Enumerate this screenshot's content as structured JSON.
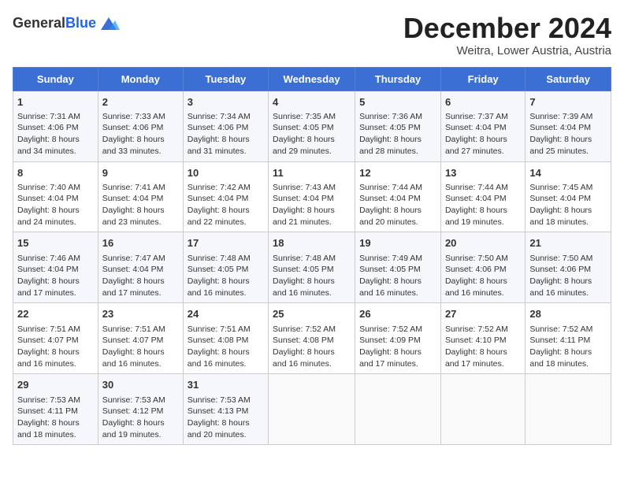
{
  "header": {
    "logo_general": "General",
    "logo_blue": "Blue",
    "month_title": "December 2024",
    "location": "Weitra, Lower Austria, Austria"
  },
  "days_of_week": [
    "Sunday",
    "Monday",
    "Tuesday",
    "Wednesday",
    "Thursday",
    "Friday",
    "Saturday"
  ],
  "weeks": [
    [
      {
        "day": "1",
        "sunrise": "7:31 AM",
        "sunset": "4:06 PM",
        "daylight": "8 hours and 34 minutes."
      },
      {
        "day": "2",
        "sunrise": "7:33 AM",
        "sunset": "4:06 PM",
        "daylight": "8 hours and 33 minutes."
      },
      {
        "day": "3",
        "sunrise": "7:34 AM",
        "sunset": "4:06 PM",
        "daylight": "8 hours and 31 minutes."
      },
      {
        "day": "4",
        "sunrise": "7:35 AM",
        "sunset": "4:05 PM",
        "daylight": "8 hours and 29 minutes."
      },
      {
        "day": "5",
        "sunrise": "7:36 AM",
        "sunset": "4:05 PM",
        "daylight": "8 hours and 28 minutes."
      },
      {
        "day": "6",
        "sunrise": "7:37 AM",
        "sunset": "4:04 PM",
        "daylight": "8 hours and 27 minutes."
      },
      {
        "day": "7",
        "sunrise": "7:39 AM",
        "sunset": "4:04 PM",
        "daylight": "8 hours and 25 minutes."
      }
    ],
    [
      {
        "day": "8",
        "sunrise": "7:40 AM",
        "sunset": "4:04 PM",
        "daylight": "8 hours and 24 minutes."
      },
      {
        "day": "9",
        "sunrise": "7:41 AM",
        "sunset": "4:04 PM",
        "daylight": "8 hours and 23 minutes."
      },
      {
        "day": "10",
        "sunrise": "7:42 AM",
        "sunset": "4:04 PM",
        "daylight": "8 hours and 22 minutes."
      },
      {
        "day": "11",
        "sunrise": "7:43 AM",
        "sunset": "4:04 PM",
        "daylight": "8 hours and 21 minutes."
      },
      {
        "day": "12",
        "sunrise": "7:44 AM",
        "sunset": "4:04 PM",
        "daylight": "8 hours and 20 minutes."
      },
      {
        "day": "13",
        "sunrise": "7:44 AM",
        "sunset": "4:04 PM",
        "daylight": "8 hours and 19 minutes."
      },
      {
        "day": "14",
        "sunrise": "7:45 AM",
        "sunset": "4:04 PM",
        "daylight": "8 hours and 18 minutes."
      }
    ],
    [
      {
        "day": "15",
        "sunrise": "7:46 AM",
        "sunset": "4:04 PM",
        "daylight": "8 hours and 17 minutes."
      },
      {
        "day": "16",
        "sunrise": "7:47 AM",
        "sunset": "4:04 PM",
        "daylight": "8 hours and 17 minutes."
      },
      {
        "day": "17",
        "sunrise": "7:48 AM",
        "sunset": "4:05 PM",
        "daylight": "8 hours and 16 minutes."
      },
      {
        "day": "18",
        "sunrise": "7:48 AM",
        "sunset": "4:05 PM",
        "daylight": "8 hours and 16 minutes."
      },
      {
        "day": "19",
        "sunrise": "7:49 AM",
        "sunset": "4:05 PM",
        "daylight": "8 hours and 16 minutes."
      },
      {
        "day": "20",
        "sunrise": "7:50 AM",
        "sunset": "4:06 PM",
        "daylight": "8 hours and 16 minutes."
      },
      {
        "day": "21",
        "sunrise": "7:50 AM",
        "sunset": "4:06 PM",
        "daylight": "8 hours and 16 minutes."
      }
    ],
    [
      {
        "day": "22",
        "sunrise": "7:51 AM",
        "sunset": "4:07 PM",
        "daylight": "8 hours and 16 minutes."
      },
      {
        "day": "23",
        "sunrise": "7:51 AM",
        "sunset": "4:07 PM",
        "daylight": "8 hours and 16 minutes."
      },
      {
        "day": "24",
        "sunrise": "7:51 AM",
        "sunset": "4:08 PM",
        "daylight": "8 hours and 16 minutes."
      },
      {
        "day": "25",
        "sunrise": "7:52 AM",
        "sunset": "4:08 PM",
        "daylight": "8 hours and 16 minutes."
      },
      {
        "day": "26",
        "sunrise": "7:52 AM",
        "sunset": "4:09 PM",
        "daylight": "8 hours and 17 minutes."
      },
      {
        "day": "27",
        "sunrise": "7:52 AM",
        "sunset": "4:10 PM",
        "daylight": "8 hours and 17 minutes."
      },
      {
        "day": "28",
        "sunrise": "7:52 AM",
        "sunset": "4:11 PM",
        "daylight": "8 hours and 18 minutes."
      }
    ],
    [
      {
        "day": "29",
        "sunrise": "7:53 AM",
        "sunset": "4:11 PM",
        "daylight": "8 hours and 18 minutes."
      },
      {
        "day": "30",
        "sunrise": "7:53 AM",
        "sunset": "4:12 PM",
        "daylight": "8 hours and 19 minutes."
      },
      {
        "day": "31",
        "sunrise": "7:53 AM",
        "sunset": "4:13 PM",
        "daylight": "8 hours and 20 minutes."
      },
      null,
      null,
      null,
      null
    ]
  ],
  "labels": {
    "sunrise": "Sunrise:",
    "sunset": "Sunset:",
    "daylight": "Daylight:"
  }
}
